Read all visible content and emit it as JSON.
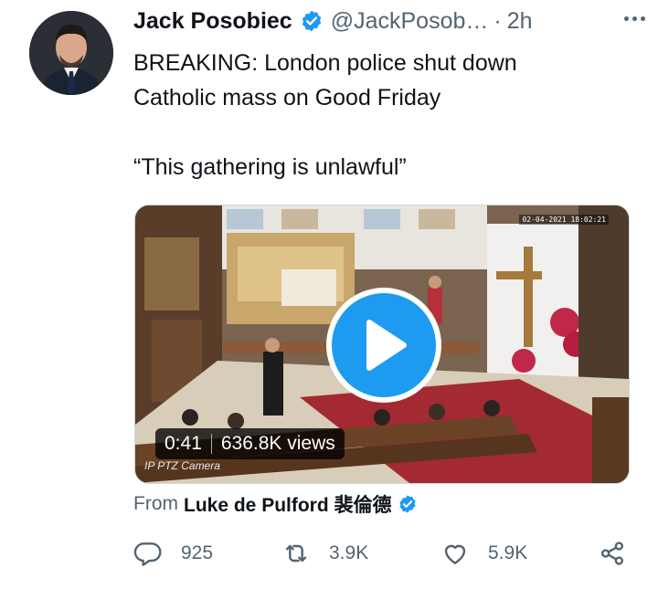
{
  "tweet": {
    "author_name": "Jack Posobiec",
    "handle": "@JackPosob…",
    "separator": "·",
    "time": "2h",
    "text": "BREAKING: London police shut down\nCatholic mass on Good Friday\n\n“This gathering is unlawful”"
  },
  "media": {
    "duration": "0:41",
    "views": "636.8K views",
    "camera_label": "IP PTZ Camera",
    "camera_timestamp": "02-04-2021 18:02:21"
  },
  "from": {
    "prefix": "From",
    "source_name": "Luke de Pulford 裴倫德"
  },
  "actions": {
    "reply_count": "925",
    "retweet_count": "3.9K",
    "like_count": "5.9K"
  },
  "colors": {
    "accent": "#1d9bf0",
    "text": "#0f1419",
    "secondary": "#536471"
  }
}
